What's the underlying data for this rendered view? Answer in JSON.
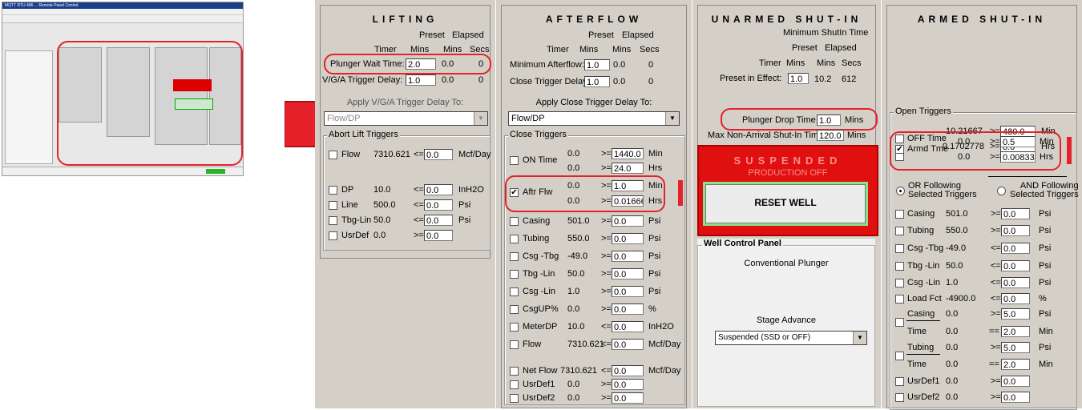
{
  "thumbnail": {
    "title": "MQTT RTU 486 ... Remote Panel Control"
  },
  "lifting": {
    "title": "LIFTING",
    "col_preset": "Preset",
    "col_elapsed": "Elapsed",
    "col_timer": "Timer",
    "col_mins": "Mins",
    "col_mins2": "Mins",
    "col_secs": "Secs",
    "plunger_wait_label": "Plunger Wait Time:",
    "plunger_wait_value": "2.0",
    "plunger_wait_elapsed": "0.0",
    "plunger_wait_secs": "0",
    "vga_label": "V/G/A Trigger Delay:",
    "vga_value": "1.0",
    "vga_elapsed": "0.0",
    "vga_secs": "0",
    "apply_label": "Apply V/G/A Trigger Delay To:",
    "apply_select": "Flow/DP",
    "abort_label": "Abort Lift Triggers",
    "triggers": [
      {
        "name": "Flow",
        "value": "7310.621",
        "op": "<=",
        "input": "0.0",
        "unit": "Mcf/Day"
      },
      {
        "name": "DP",
        "value": "10.0",
        "op": "<=",
        "input": "0.0",
        "unit": "InH2O"
      },
      {
        "name": "Line",
        "value": "500.0",
        "op": "<=",
        "input": "0.0",
        "unit": "Psi"
      },
      {
        "name": "Tbg-Lin",
        "value": "50.0",
        "op": "<=",
        "input": "0.0",
        "unit": "Psi"
      },
      {
        "name": "UsrDef",
        "value": "0.0",
        "op": ">=",
        "input": "0.0",
        "unit": ""
      }
    ]
  },
  "afterflow": {
    "title": "AFTERFLOW",
    "col_preset": "Preset",
    "col_elapsed": "Elapsed",
    "col_timer": "Timer",
    "col_mins": "Mins",
    "col_mins2": "Mins",
    "col_secs": "Secs",
    "min_label": "Minimum Afterflow:",
    "min_value": "1.0",
    "min_elapsed": "0.0",
    "min_secs": "0",
    "close_delay_label": "Close Trigger Delay:",
    "close_delay_value": "1.0",
    "close_delay_elapsed": "0.0",
    "close_delay_secs": "0",
    "apply_label": "Apply Close Trigger Delay To:",
    "apply_select": "Flow/DP",
    "close_label": "Close Triggers",
    "on_time": {
      "name": "ON Time",
      "v1": "0.0",
      "op1": ">=",
      "in1": "1440.0",
      "u1": "Min",
      "v2": "0.0",
      "op2": ">=",
      "in2": "24.0",
      "u2": "Hrs"
    },
    "aftr_flw": {
      "name": "Aftr Flw",
      "v1": "0.0",
      "op1": ">=",
      "in1": "1.0",
      "u1": "Min",
      "v2": "0.0",
      "op2": ">=",
      "in2": "0.0166667",
      "u2": "Hrs"
    },
    "triggers": [
      {
        "name": "Casing",
        "value": "501.0",
        "op": ">=",
        "input": "0.0",
        "unit": "Psi"
      },
      {
        "name": "Tubing",
        "value": "550.0",
        "op": ">=",
        "input": "0.0",
        "unit": "Psi"
      },
      {
        "name": "Csg -Tbg",
        "value": "-49.0",
        "op": ">=",
        "input": "0.0",
        "unit": "Psi"
      },
      {
        "name": "Tbg -Lin",
        "value": "50.0",
        "op": ">=",
        "input": "0.0",
        "unit": "Psi"
      },
      {
        "name": "Csg -Lin",
        "value": "1.0",
        "op": ">=",
        "input": "0.0",
        "unit": "Psi"
      },
      {
        "name": "CsgUP%",
        "value": "0.0",
        "op": ">=",
        "input": "0.0",
        "unit": "%"
      },
      {
        "name": "MeterDP",
        "value": "10.0",
        "op": "<=",
        "input": "0.0",
        "unit": "InH2O"
      },
      {
        "name": "Flow",
        "value": "7310.621",
        "op": "<=",
        "input": "0.0",
        "unit": "Mcf/Day"
      }
    ],
    "triggers2": [
      {
        "name": "Net Flow",
        "value": "7310.621",
        "op": "<=",
        "input": "0.0",
        "unit": "Mcf/Day"
      },
      {
        "name": "UsrDef1",
        "value": "0.0",
        "op": ">=",
        "input": "0.0",
        "unit": ""
      },
      {
        "name": "UsrDef2",
        "value": "0.0",
        "op": ">=",
        "input": "0.0",
        "unit": ""
      }
    ]
  },
  "unarmed": {
    "title": "UNARMED SHUT-IN",
    "min_label": "Minimum ShutIn Time",
    "col_preset": "Preset",
    "col_elapsed": "Elapsed",
    "col_timer": "Timer",
    "col_mins": "Mins",
    "col_mins2": "Mins",
    "col_secs": "Secs",
    "preset_label": "Preset in Effect:",
    "preset_value": "1.0",
    "preset_elapsed": "10.2",
    "preset_secs": "612",
    "drop_label": "Plunger Drop Time",
    "drop_value": "1.0",
    "drop_unit": "Mins",
    "nonarrival_label": "Max Non-Arrival Shut-In Time:",
    "nonarrival_value": "120.0",
    "nonarrival_unit": "Mins",
    "status": "SUSPENDED",
    "status_sub": "PRODUCTION OFF",
    "reset_label": "RESET WELL",
    "wcp_label": "Well Control Panel",
    "mode": "Conventional Plunger",
    "stage_label": "Stage Advance",
    "stage_select": "Suspended (SSD or OFF)"
  },
  "armed": {
    "title": "ARMED SHUT-IN",
    "open_label": "Open Triggers",
    "off_time": {
      "name": "OFF Time",
      "v1": "10.21667",
      "op1": ">=",
      "in1": "480.0",
      "u1": "Min",
      "v2": "0.1702778",
      "op2": ">=",
      "in2": "8.0",
      "u2": "Hrs"
    },
    "armd_tme": {
      "name": "Armd Tme",
      "v1": "0.0",
      "op1": ">=",
      "in1": "0.5",
      "u1": "Min",
      "v2": "0.0",
      "op2": ">=",
      "in2": "0.008333",
      "u2": "Hrs"
    },
    "or_label": "OR Following Selected Triggers",
    "and_label": "AND Following Selected Triggers",
    "or_l1": "OR Following",
    "or_l2": "Selected Triggers",
    "and_l1": "AND Following",
    "and_l2": "Selected Triggers",
    "triggers": [
      {
        "name": "Casing",
        "value": "501.0",
        "op": ">=",
        "input": "0.0",
        "unit": "Psi"
      },
      {
        "name": "Tubing",
        "value": "550.0",
        "op": ">=",
        "input": "0.0",
        "unit": "Psi"
      },
      {
        "name": "Csg -Tbg",
        "value": "-49.0",
        "op": "<=",
        "input": "0.0",
        "unit": "Psi"
      },
      {
        "name": "Tbg -Lin",
        "value": "50.0",
        "op": "<=",
        "input": "0.0",
        "unit": "Psi"
      },
      {
        "name": "Csg -Lin",
        "value": "1.0",
        "op": "<=",
        "input": "0.0",
        "unit": "Psi"
      },
      {
        "name": "Load Fct",
        "value": "-4900.0",
        "op": "<=",
        "input": "0.0",
        "unit": "%"
      }
    ],
    "casing_time": {
      "name": "Casing",
      "value": "0.0",
      "op": ">=",
      "input": "5.0",
      "unit": "Psi",
      "tname": "Time",
      "tvalue": "0.0",
      "top": "==",
      "tinput": "2.0",
      "tunit": "Min"
    },
    "tubing_time": {
      "name": "Tubing",
      "value": "0.0",
      "op": ">=",
      "input": "5.0",
      "unit": "Psi",
      "tname": "Time",
      "tvalue": "0.0",
      "top": "==",
      "tinput": "2.0",
      "tunit": "Min"
    },
    "triggers2": [
      {
        "name": "UsrDef1",
        "value": "0.0",
        "op": ">=",
        "input": "0.0",
        "unit": ""
      },
      {
        "name": "UsrDef2",
        "value": "0.0",
        "op": ">=",
        "input": "0.0",
        "unit": ""
      }
    ]
  }
}
